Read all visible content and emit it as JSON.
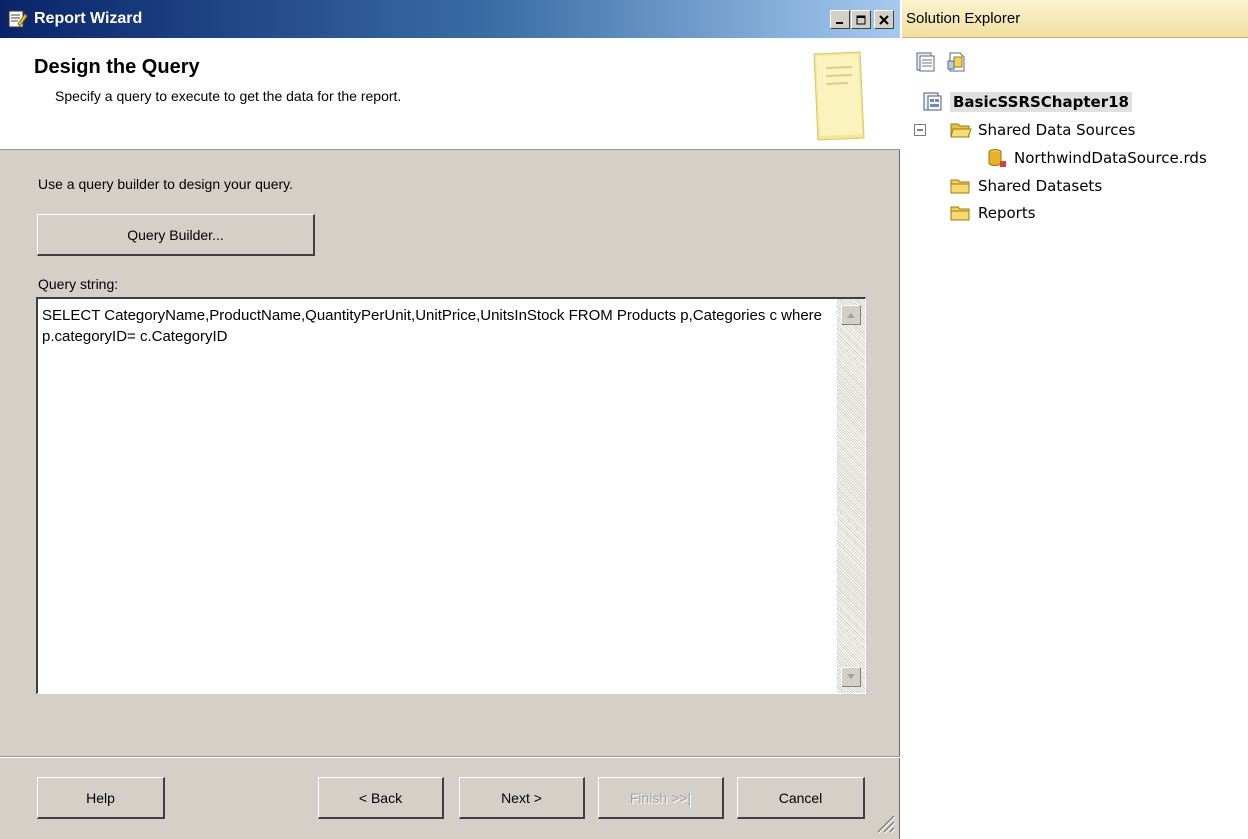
{
  "wizard": {
    "title": "Report Wizard",
    "header": {
      "title": "Design the Query",
      "subtitle": "Specify a query to execute to get the data for the report."
    },
    "instruction": "Use a query builder to design your query.",
    "query_builder_label": "Query Builder...",
    "query_string_label": "Query string:",
    "query_string_value": "SELECT CategoryName,ProductName,QuantityPerUnit,UnitPrice,UnitsInStock FROM Products p,Categories c where p.categoryID= c.CategoryID",
    "buttons": {
      "help": "Help",
      "back": "< Back",
      "next": "Next >",
      "finish": "Finish >>|",
      "cancel": "Cancel"
    }
  },
  "solution_explorer": {
    "title": "Solution Explorer",
    "tree": {
      "root": "BasicSSRSChapter18",
      "shared_data_sources": "Shared Data Sources",
      "data_source_file": "NorthwindDataSource.rds",
      "shared_datasets": "Shared Datasets",
      "reports": "Reports"
    }
  },
  "colors": {
    "titlebar_dark": "#0a246a",
    "titlebar_light": "#a6caf0",
    "dialog_face": "#d4d0c8",
    "solex_title": "#f0dfa0"
  }
}
